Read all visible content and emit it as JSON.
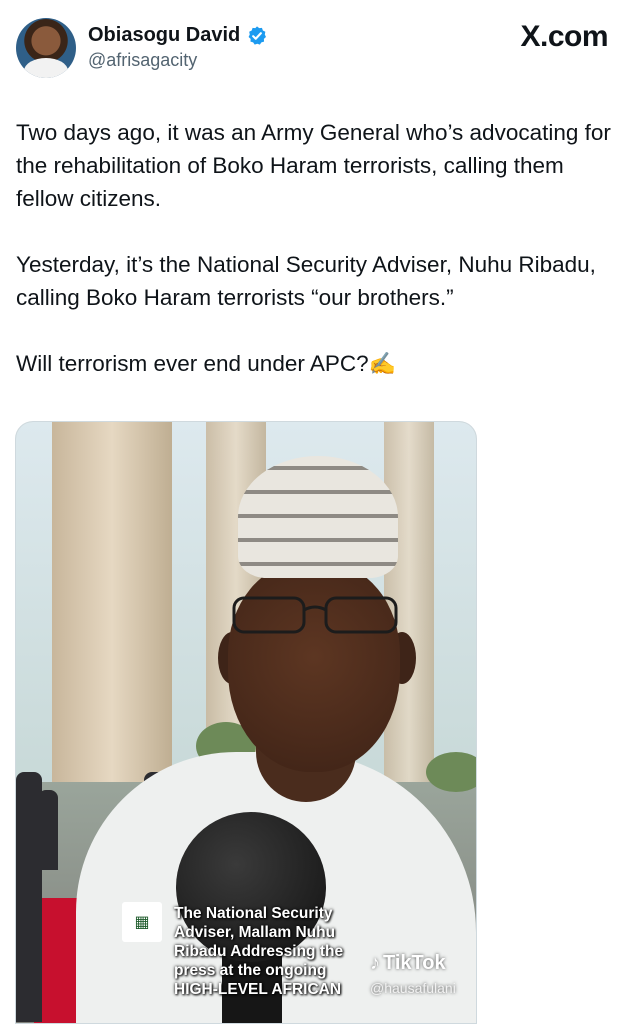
{
  "author": {
    "name": "Obiasogu David",
    "handle": "@afrisagacity",
    "verified": true,
    "avatar_icon": "profile-photo"
  },
  "site_label": "X.com",
  "post": {
    "paragraphs": [
      "Two days ago, it was an Army General who’s advocating for the rehabilitation of Boko Haram terrorists, calling them fellow citizens.",
      "Yesterday, it’s the National Security Adviser, Nuhu Ribadu, calling Boko Haram terrorists “our brothers.”",
      "Will terrorism ever end under APC?"
    ],
    "emoji": "✍️"
  },
  "media": {
    "caption_lines": [
      "The National Security",
      "Adviser, Mallam Nuhu",
      "Ribadu Addressing the",
      "press at the ongoing",
      "HIGH-LEVEL AFRICAN"
    ],
    "watermark": "TikTok",
    "watermark_handle": "@hausafulani"
  },
  "colors": {
    "text": "#0f1419",
    "secondary_text": "#536471",
    "verified_blue": "#1d9bf0"
  }
}
